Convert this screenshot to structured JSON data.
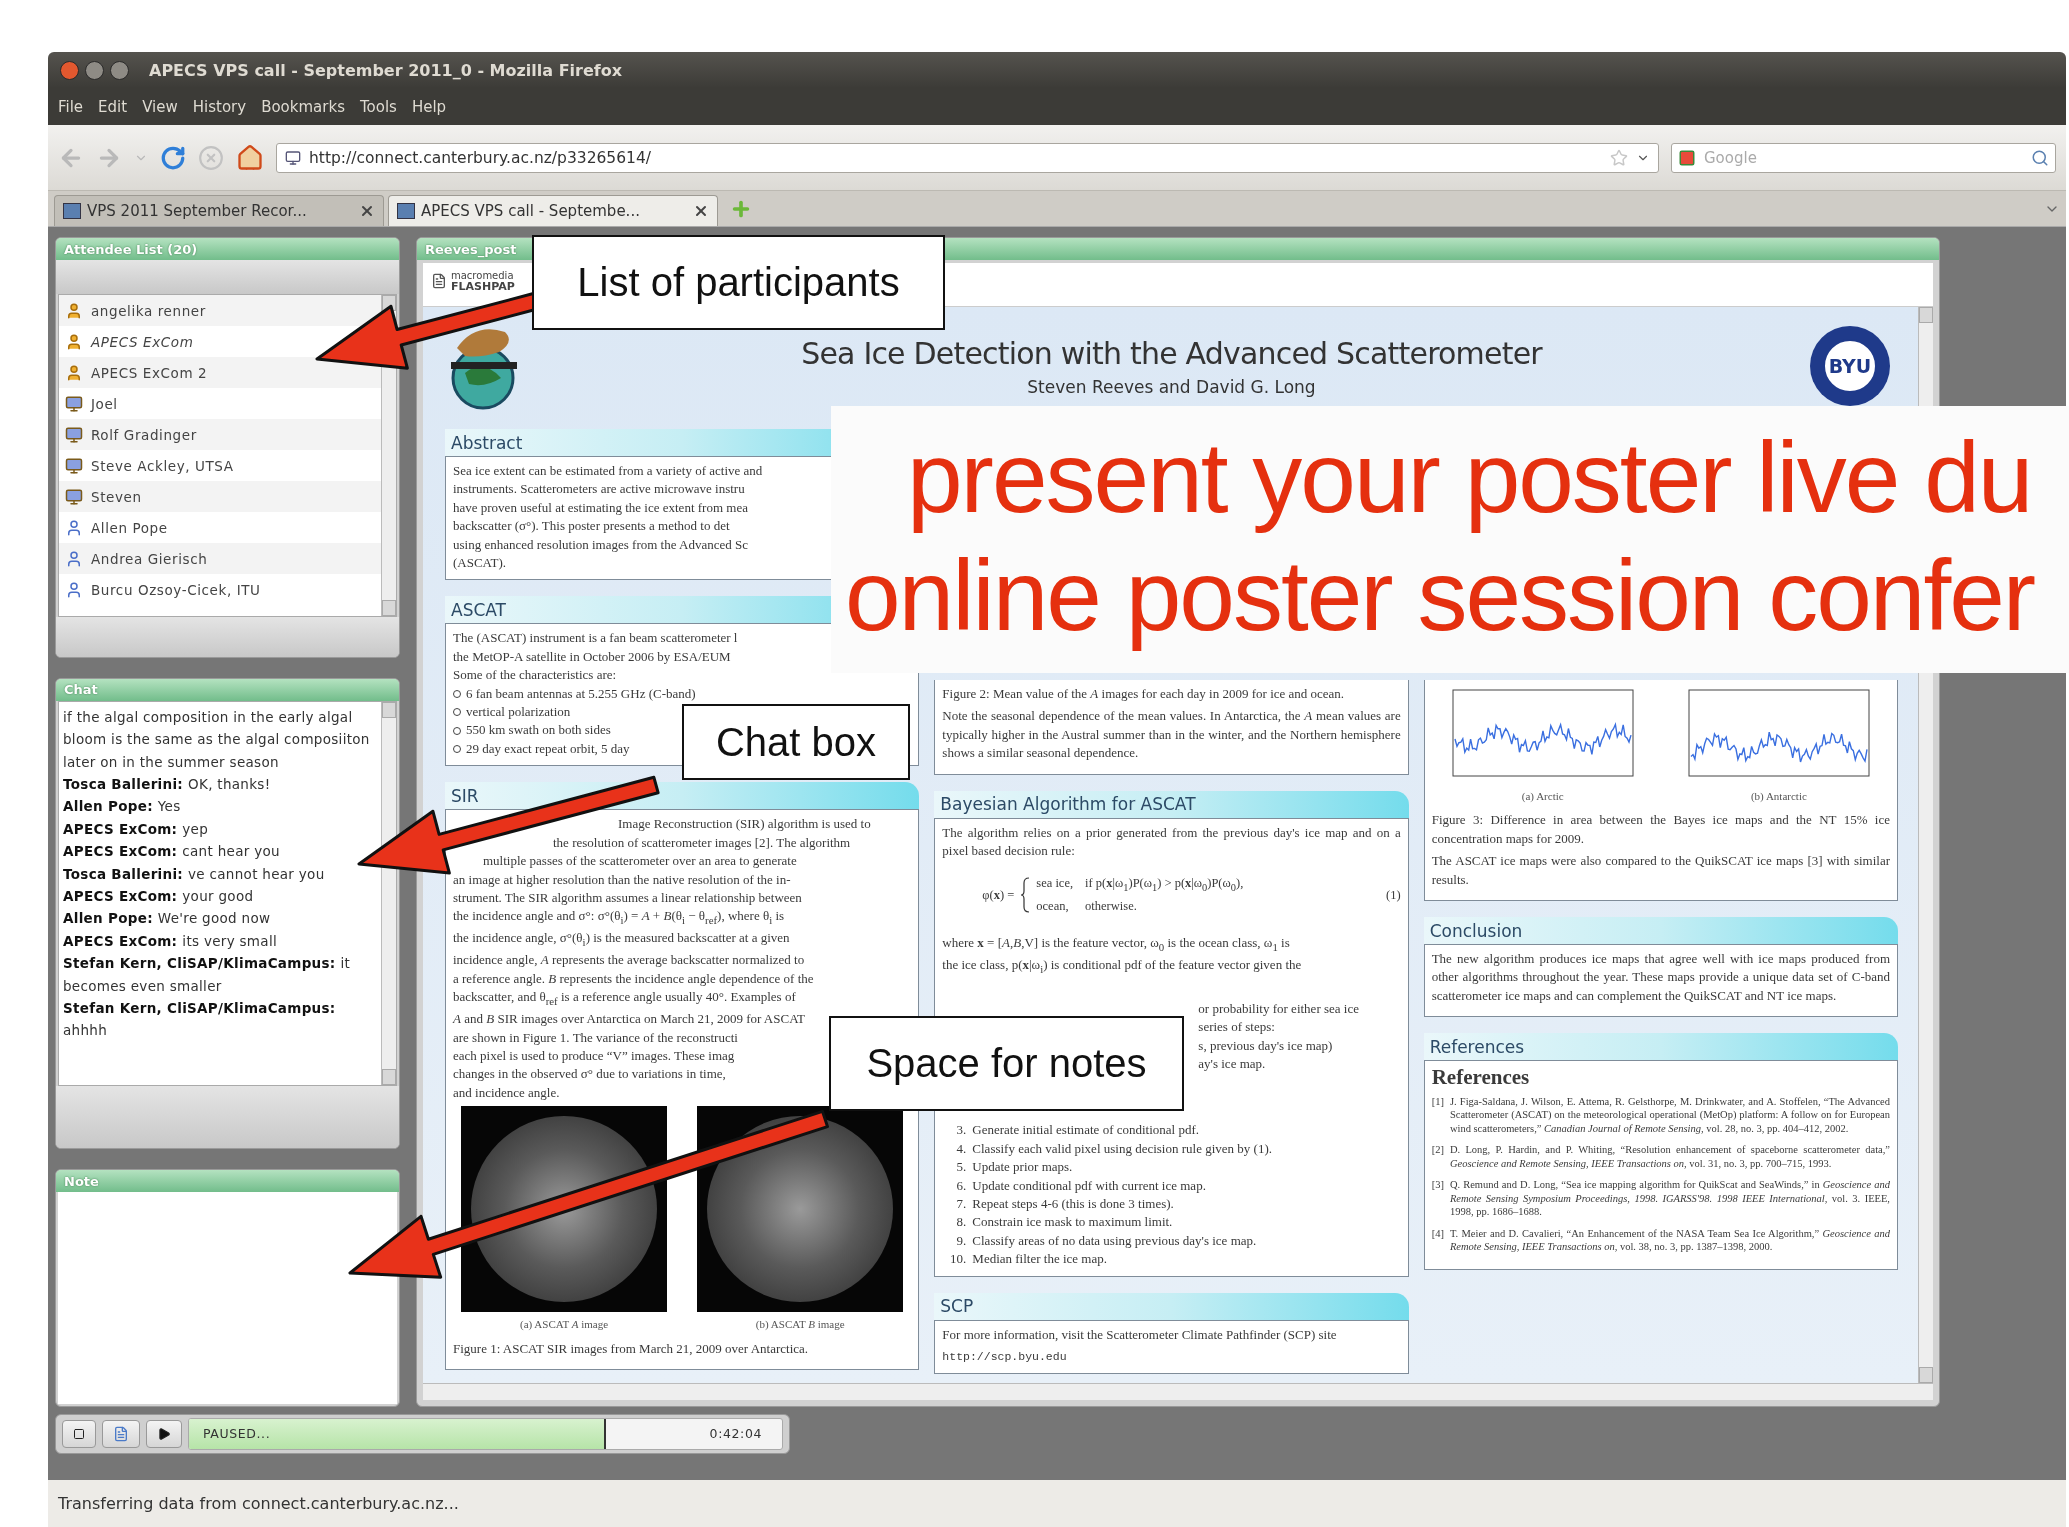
{
  "window": {
    "title": "APECS VPS call - September 2011_0 - Mozilla Firefox"
  },
  "menu": [
    "File",
    "Edit",
    "View",
    "History",
    "Bookmarks",
    "Tools",
    "Help"
  ],
  "address_bar": {
    "url": "http://connect.canterbury.ac.nz/p33265614/"
  },
  "search": {
    "placeholder": "Google"
  },
  "tabs": [
    {
      "label": "VPS 2011 September Recor...",
      "selected": false
    },
    {
      "label": "APECS VPS call - Septembe...",
      "selected": true
    }
  ],
  "attendee_panel": {
    "title": "Attendee List (20)",
    "attendees": [
      {
        "name": "angelika renner",
        "kind": "host",
        "emphasized": false
      },
      {
        "name": "APECS  ExCom",
        "kind": "host",
        "emphasized": true
      },
      {
        "name": "APECS  ExCom 2",
        "kind": "host",
        "emphasized": false
      },
      {
        "name": "Joel",
        "kind": "presenter",
        "emphasized": false
      },
      {
        "name": "Rolf Gradinger",
        "kind": "presenter",
        "emphasized": false
      },
      {
        "name": "Steve Ackley, UTSA",
        "kind": "presenter",
        "emphasized": false
      },
      {
        "name": "Steven",
        "kind": "presenter",
        "emphasized": false
      },
      {
        "name": "Allen Pope",
        "kind": "participant",
        "emphasized": false
      },
      {
        "name": "Andrea Gierisch",
        "kind": "participant",
        "emphasized": false
      },
      {
        "name": "Burcu Ozsoy-Cicek, ITU",
        "kind": "participant",
        "emphasized": false
      }
    ]
  },
  "chat_panel": {
    "title": "Chat",
    "messages": [
      {
        "text": "if the algal composition in the early algal bloom is the same as the algal composiiton later on in the summer season"
      },
      {
        "sender": "Tosca Ballerini:",
        "text": "OK, thanks!"
      },
      {
        "sender": "Allen Pope:",
        "text": "Yes"
      },
      {
        "sender": "APECS  ExCom:",
        "text": "yep"
      },
      {
        "sender": "APECS  ExCom:",
        "text": "cant hear you"
      },
      {
        "sender": "Tosca Ballerini:",
        "text": "ve cannot hear you"
      },
      {
        "sender": "APECS  ExCom:",
        "text": "your good"
      },
      {
        "sender": "Allen Pope:",
        "text": "We're good now"
      },
      {
        "sender": "APECS  ExCom:",
        "text": "its very small"
      },
      {
        "sender": "Stefan Kern, CliSAP/KlimaCampus:",
        "text": "it becomes even smaller"
      },
      {
        "sender": "Stefan Kern, CliSAP/KlimaCampus:",
        "text": "ahhhh"
      }
    ]
  },
  "note_panel": {
    "title": "Note"
  },
  "playback": {
    "status": "PAUSED...",
    "level": 0.7,
    "time": "0:42:04"
  },
  "poster_pod": {
    "title": "Reeves_post",
    "viewer_logo": {
      "brand": "macromedia",
      "product": "FLASHPAP"
    },
    "poster": {
      "title": "Sea Ice Detection with the Advanced Scatterometer",
      "authors": "Steven Reeves and David G. Long",
      "seal_text": "BYU",
      "columns": [
        {
          "sections": [
            {
              "heading": "Abstract",
              "blocks": [
                {
                  "kind": "lines",
                  "lines": [
                    "Sea ice extent can be estimated from a variety of active and",
                    "instruments. Scatterometers are active microwave instru",
                    "have proven useful at estimating the ice extent from mea",
                    "backscatter (σ°). This poster presents a method to det",
                    "using enhanced resolution images from the Advanced Sc",
                    "(ASCAT)."
                  ]
                }
              ]
            },
            {
              "heading": "ASCAT",
              "blocks": [
                {
                  "kind": "lines",
                  "lines": [
                    "The (ASCAT) instrument is a fan beam scatterometer l",
                    "the MetOP-A satellite in October 2006 by ESA/EUM",
                    "Some of the characteristics are:"
                  ]
                },
                {
                  "kind": "bullets",
                  "items": [
                    "6 fan beam antennas at 5.255 GHz (C-band)",
                    "vertical polarization",
                    "550 km swath on both sides",
                    "29 day exact repeat orbit, 5 day"
                  ]
                }
              ]
            },
            {
              "heading": "SIR",
              "blocks": [
                {
                  "kind": "indented_lines",
                  "lines": [
                    "Image Reconstruction (SIR) algorithm is used to",
                    "the resolution of scatterometer images [2]. The algorithm",
                    "multiple passes of the scatterometer over an area to generate",
                    "an image at higher resolution than the native resolution of the in-",
                    "strument. The SIR algorithm assumes a linear relationship between",
                    "the incidence angle and σ°: σ°(θ$_{i}$) = *A* + *B*(θ$_{i}$ − θ$_{ref}$), where θ$_{i}$ is",
                    "the incidence angle, σ°(θ$_{i}$) is the measured backscatter at a given",
                    "incidence angle, *A* represents the average backscatter normalized to",
                    "a reference angle. *B* represents the incidence angle dependence of the",
                    "backscatter, and θ$_{ref}$ is a reference angle usually 40°. Examples of",
                    "*A* and *B* SIR images over Antarctica on March 21, 2009 for ASCAT",
                    "are shown in Figure 1. The variance of the reconstructi",
                    "each pixel is used to produce “V” images. These imag",
                    "changes in the observed σ° due to variations in time,",
                    "and incidence angle."
                  ]
                },
                {
                  "kind": "images",
                  "images": [
                    {
                      "caption": "(a) ASCAT *A* image"
                    },
                    {
                      "caption": "(b) ASCAT *B* image"
                    }
                  ],
                  "figure_caption": "Figure 1: ASCAT SIR images from March 21, 2009 over Antarctica."
                }
              ]
            }
          ]
        },
        {
          "sections": [
            {
              "blocks": [
                {
                  "kind": "paragraph",
                  "text": "Figure 2: Mean value of the *A* images for each day in 2009 for ice and ocean."
                },
                {
                  "kind": "paragraph",
                  "text": "Note the seasonal dependence of the mean values. In Antarctica, the *A* mean values are typically higher in the Austral summer than in the winter, and the Northern hemisphere shows a similar seasonal dependence."
                }
              ]
            },
            {
              "heading": "Bayesian Algorithm for ASCAT",
              "blocks": [
                {
                  "kind": "paragraph",
                  "text": "The algorithm relies on a prior generated from the previous day's ice map and on a pixel based decision rule:"
                },
                {
                  "kind": "equation",
                  "lhs": "φ(**x**) =",
                  "cases": [
                    {
                      "value": "sea ice,",
                      "condition": "if p(**x**|ω$_{1}$)P(ω$_{1}$) > p(**x**|ω$_{0}$)P(ω$_{0}$),"
                    },
                    {
                      "value": "ocean,",
                      "condition": "otherwise."
                    }
                  ],
                  "number": "(1)"
                },
                {
                  "kind": "lines",
                  "lines": [
                    "where **x** = [*A*,*B*,V] is the feature vector, ω$_{0}$ is the ocean class, ω$_{1}$ is",
                    "the ice class, p(**x**|ω$_{i}$) is conditional pdf of the feature vector given the"
                  ]
                },
                {
                  "kind": "right_fragments",
                  "lines": [
                    "or probability for either sea ice",
                    "series of steps:",
                    "s, previous day's ice map)",
                    "ay's ice map."
                  ]
                },
                {
                  "kind": "steps",
                  "items": [
                    {
                      "number": "3.",
                      "text": "Generate initial estimate of conditional pdf."
                    },
                    {
                      "number": "4.",
                      "text": "Classify each valid pixel using decision rule given by (1)."
                    },
                    {
                      "number": "5.",
                      "text": "Update prior maps."
                    },
                    {
                      "number": "6.",
                      "text": "Update conditional pdf with current ice map."
                    },
                    {
                      "number": "7.",
                      "text": "Repeat steps 4-6 (this is done 3 times)."
                    },
                    {
                      "number": "8.",
                      "text": "Constrain ice mask to maximum limit."
                    },
                    {
                      "number": "9.",
                      "text": "Classify areas of no data using previous day's ice map."
                    },
                    {
                      "number": "10.",
                      "text": "Median filter the ice map."
                    }
                  ]
                }
              ]
            },
            {
              "heading": "SCP",
              "blocks": [
                {
                  "kind": "paragraph",
                  "text": "For more information, visit the Scatterometer Climate Pathfinder (SCP) site"
                },
                {
                  "kind": "link",
                  "text": "http://scp.byu.edu"
                }
              ]
            }
          ]
        },
        {
          "sections": [
            {
              "blocks": [
                {
                  "kind": "charts",
                  "charts": [
                    {
                      "caption": "(a) Arctic"
                    },
                    {
                      "caption": "(b) Antarctic"
                    }
                  ],
                  "series": [
                    {
                      "color": "#3a6fe0"
                    }
                  ],
                  "figure_caption": "Figure 3: Difference in area between the Bayes ice maps and the NT 15% ice concentration maps for 2009."
                },
                {
                  "kind": "paragraph",
                  "text": "The ASCAT ice maps were also compared to the QuikSCAT ice maps [3] with similar results."
                }
              ]
            },
            {
              "heading": "Conclusion",
              "blocks": [
                {
                  "kind": "paragraph",
                  "text": "The new algorithm produces ice maps that agree well with ice maps produced from other algorithms throughout the year. These maps provide a unique data set of C-band scatterometer ice maps and can complement the QuikSCAT and NT ice maps."
                }
              ]
            },
            {
              "heading": "References",
              "blocks": [
                {
                  "kind": "references",
                  "title": "References",
                  "items": [
                    {
                      "number": "[1]",
                      "text": "J. Figa-Saldana, J. Wilson, E. Attema, R. Gelsthorpe, M. Drinkwater, and A. Stoffelen, “The Advanced Scatterometer (ASCAT) on the meteorological operational (MetOp) platform: A follow on for European wind scatterometers,” *Canadian Journal of Remote Sensing*, vol. 28, no. 3, pp. 404–412, 2002."
                    },
                    {
                      "number": "[2]",
                      "text": "D. Long, P. Hardin, and P. Whiting, “Resolution enhancement of spaceborne scatterometer data,” *Geoscience and Remote Sensing, IEEE Transactions on*, vol. 31, no. 3, pp. 700–715, 1993."
                    },
                    {
                      "number": "[3]",
                      "text": "Q. Remund and D. Long, “Sea ice mapping algorithm for QuikScat and SeaWinds,” in *Geoscience and Remote Sensing Symposium Proceedings, 1998. IGARSS'98. 1998 IEEE International*, vol. 3. IEEE, 1998, pp. 1686–1688."
                    },
                    {
                      "number": "[4]",
                      "text": "T. Meier and D. Cavalieri, “An Enhancement of the NASA Team Sea Ice Algorithm,” *Geoscience and Remote Sensing, IEEE Transactions on*, vol. 38, no. 3, pp. 1387–1398, 2000."
                    }
                  ]
                }
              ]
            }
          ]
        }
      ]
    }
  },
  "status_bar": "Transferring data from connect.canterbury.ac.nz...",
  "callouts": [
    {
      "label": "List of participants"
    },
    {
      "label": "Chat box"
    },
    {
      "label": "Space for notes"
    }
  ],
  "banner": {
    "lines": [
      "present your poster live du",
      "online poster session confer"
    ]
  }
}
